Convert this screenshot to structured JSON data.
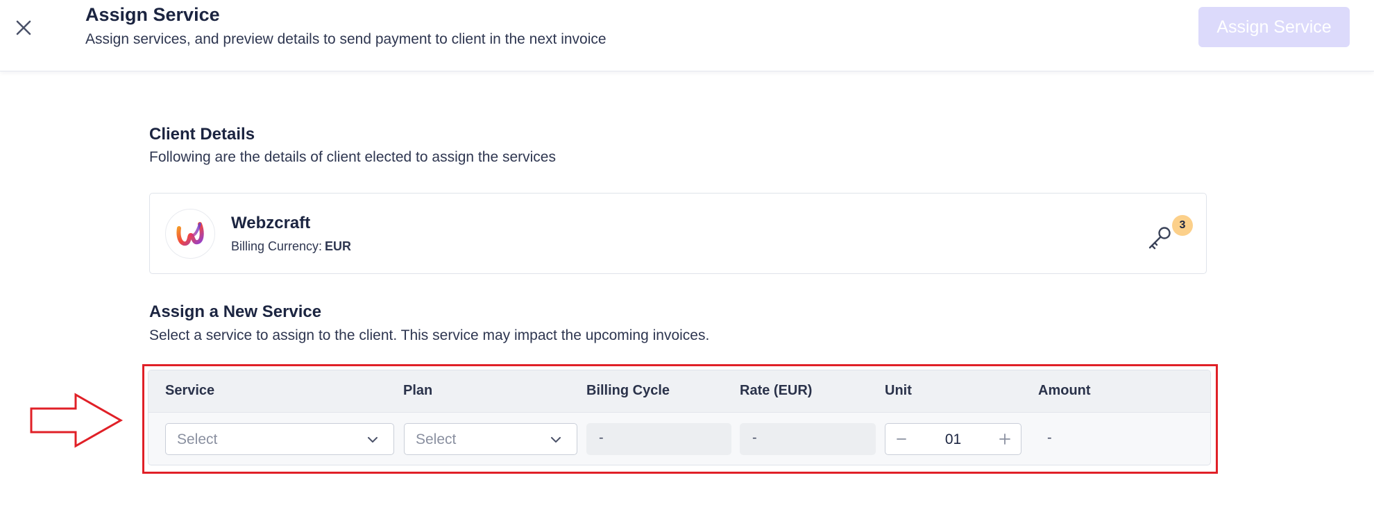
{
  "header": {
    "title": "Assign Service",
    "subtitle": "Assign services, and preview details to send payment to client in the next invoice",
    "assign_button_label": "Assign Service",
    "close_icon": "close-icon"
  },
  "client_section": {
    "title": "Client Details",
    "description": "Following are the details of client elected to assign the services"
  },
  "client": {
    "name": "Webzcraft",
    "currency_label": "Billing Currency:",
    "currency_value": "EUR",
    "logo_icon": "webzcraft-logo",
    "key_icon": "key-icon",
    "key_badge_count": "3"
  },
  "assign_section": {
    "title": "Assign a New Service",
    "description": "Select a service to assign to the client. This service may impact the upcoming invoices."
  },
  "table": {
    "headers": [
      "Service",
      "Plan",
      "Billing Cycle",
      "Rate (EUR)",
      "Unit",
      "Amount"
    ],
    "row": {
      "service_placeholder": "Select",
      "plan_placeholder": "Select",
      "billing_cycle": "-",
      "rate": "-",
      "unit_value": "01",
      "amount": "-"
    }
  },
  "colors": {
    "primary_disabled": "#dcdafb",
    "annotation_red": "#e02027",
    "badge": "#fcd08a",
    "text_dark": "#1b2440"
  }
}
